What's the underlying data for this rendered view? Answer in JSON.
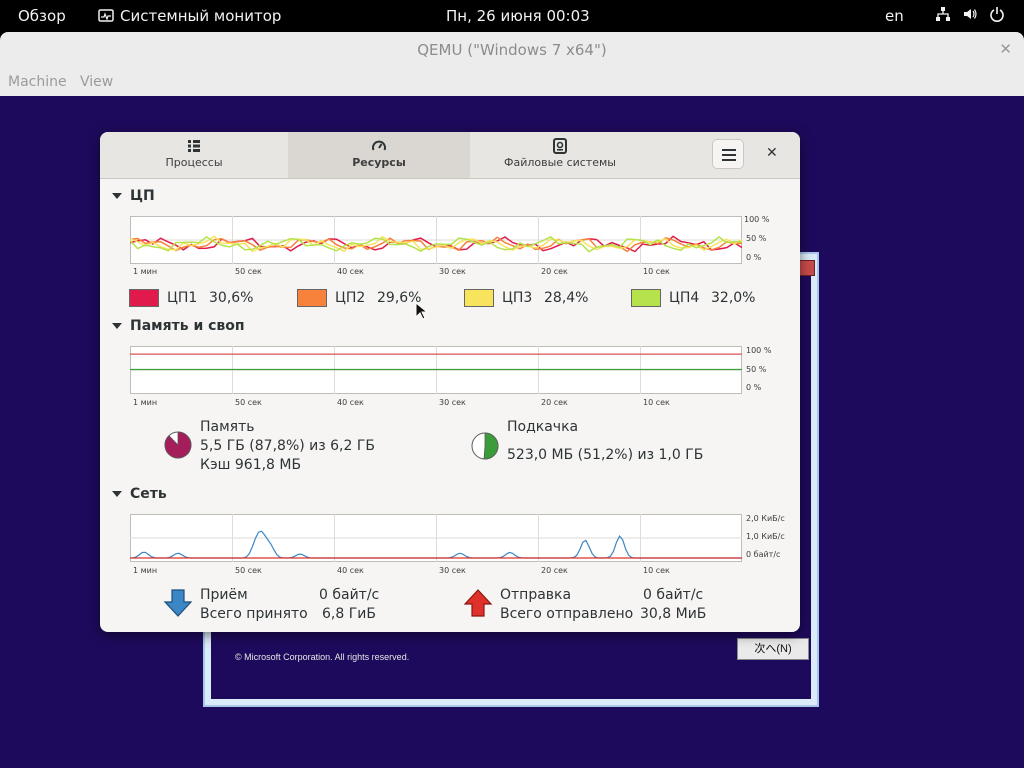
{
  "topbar": {
    "activities": "Обзор",
    "app_name": "Системный монитор",
    "datetime": "Пн, 26 июня  00:03",
    "lang": "en"
  },
  "qemu": {
    "title": "QEMU (\"Windows 7 x64\")",
    "menu": [
      "Machine",
      "View"
    ]
  },
  "guest": {
    "copyright": "© Microsoft Corporation. All rights reserved.",
    "next_button": "次へ(N)"
  },
  "sysmon": {
    "tabs": [
      {
        "label": "Процессы",
        "icon": "list-icon"
      },
      {
        "label": "Ресурсы",
        "icon": "gauge-icon"
      },
      {
        "label": "Файловые системы",
        "icon": "disk-icon"
      }
    ],
    "time_ticks": [
      "1 мин",
      "50 сек",
      "40 сек",
      "30 сек",
      "20 сек",
      "10 сек"
    ],
    "cpu": {
      "title": "ЦП",
      "y_ticks": [
        "100 %",
        "50 %",
        "0 %"
      ],
      "series": [
        {
          "name": "ЦП1",
          "value": "30,6%",
          "color": "#e01b4c"
        },
        {
          "name": "ЦП2",
          "value": "29,6%",
          "color": "#f6823b"
        },
        {
          "name": "ЦП3",
          "value": "28,4%",
          "color": "#f8e45c"
        },
        {
          "name": "ЦП4",
          "value": "32,0%",
          "color": "#b6e34c"
        }
      ]
    },
    "memory": {
      "title": "Память и своп",
      "y_ticks": [
        "100 %",
        "50 %",
        "0 %"
      ],
      "mem_label": "Память",
      "mem_value": "5,5 ГБ (87,8%) из 6,2 ГБ",
      "mem_cache": "Кэш 961,8 МБ",
      "mem_fraction": 0.878,
      "mem_color": "#a51d5b",
      "swap_label": "Подкачка",
      "swap_value": "523,0 МБ (51,2%) из 1,0 ГБ",
      "swap_fraction": 0.512,
      "swap_color": "#3a9d3a"
    },
    "network": {
      "title": "Сеть",
      "y_ticks": [
        "2,0 КиБ/с",
        "1,0 КиБ/с",
        "0 байт/с"
      ],
      "recv_label": "Приём",
      "recv_rate": "0 байт/с",
      "recv_total_label": "Всего принято",
      "recv_total": "6,8 ГиБ",
      "send_label": "Отправка",
      "send_rate": "0 байт/с",
      "send_total_label": "Всего отправлено",
      "send_total": "30,8 МиБ"
    }
  }
}
